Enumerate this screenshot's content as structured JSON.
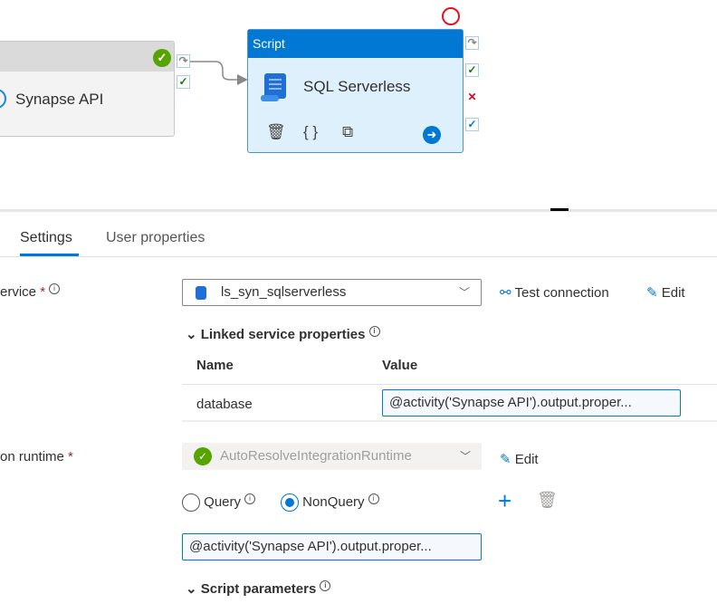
{
  "canvas": {
    "activity1": {
      "name": "Synapse API",
      "status": "succeeded"
    },
    "activity2": {
      "type": "Script",
      "name": "SQL Serverless",
      "icons": [
        "delete-icon",
        "code-icon",
        "copy-icon",
        "arrow-right-icon"
      ]
    }
  },
  "tabs": [
    {
      "label": "Settings",
      "active": true
    },
    {
      "label": "User properties",
      "active": false
    }
  ],
  "settings": {
    "linked_service_label": "ervice",
    "required": "*",
    "linked_service_value": "ls_syn_sqlserverless",
    "test_connection": "Test connection",
    "edit": "Edit",
    "linked_props_label": "Linked service properties",
    "col_name": "Name",
    "col_value": "Value",
    "rows": [
      {
        "name": "database",
        "value": "@activity('Synapse API').output.proper..."
      }
    ],
    "runtime_label": "on runtime",
    "runtime_value": "AutoResolveIntegrationRuntime",
    "runtime_edit": "Edit",
    "radio_query": "Query",
    "radio_nonquery": "NonQuery",
    "selected_type": "NonQuery",
    "script_value": "@activity('Synapse API').output.proper...",
    "script_params_label": "Script parameters"
  },
  "colors": {
    "accent": "#0078d4",
    "success": "#57a300",
    "error": "#c50f1f"
  }
}
